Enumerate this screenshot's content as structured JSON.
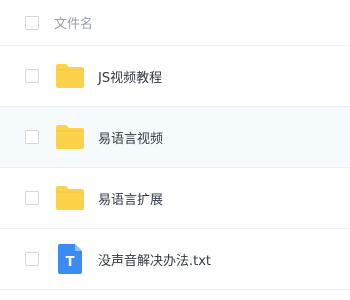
{
  "header": {
    "column_label": "文件名"
  },
  "files": [
    {
      "name": "JS视频教程",
      "icon": "folder-icon",
      "type": "folder"
    },
    {
      "name": "易语言视频",
      "icon": "folder-icon",
      "type": "folder"
    },
    {
      "name": "易语言扩展",
      "icon": "folder-icon",
      "type": "folder"
    },
    {
      "name": "没声音解决办法.txt",
      "icon": "txt-file-icon",
      "type": "txt",
      "icon_letter": "T"
    }
  ],
  "colors": {
    "folder": "#fdd24b",
    "txt_icon": "#3b8cf2",
    "hover_row": "#f5fafd"
  }
}
